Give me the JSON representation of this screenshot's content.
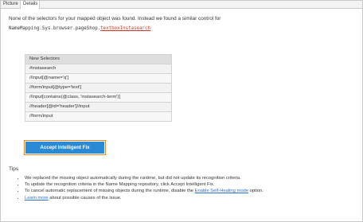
{
  "tabs": [
    {
      "label": "Picture",
      "active": false
    },
    {
      "label": "Details",
      "active": true
    }
  ],
  "message": "None of the selectors for your mapped object was found. Instead we found a similar control for",
  "path": {
    "prefix": "NameMapping.Sys.browser.pageShop.",
    "highlight": "textboxInstasearch"
  },
  "selectors": {
    "header": "New Selectors",
    "rows": [
      "#instasearch",
      "//input[@name='q']",
      "//form/input[@type='text']",
      "//input[contains(@class, 'instasearch-term')]",
      "//header[@id='header']//input",
      "//form/input"
    ]
  },
  "accept_button": "Accept Intelligent Fix",
  "tips": {
    "title": "Tips",
    "items": [
      {
        "text": "We replaced the missing object automatically during the runtime, but did not update its recognition criteria."
      },
      {
        "text": "To update the recognition criteria in the Name Mapping repository, click Accept Intelligent Fix."
      },
      {
        "pre": "To cancel automatic replacement of missing objects during the runtime, disable the ",
        "link": "Enable Self-Healing mode",
        "post": " option."
      },
      {
        "link": "Learn more",
        "post": " about possible causes of the issue."
      }
    ]
  },
  "colors": {
    "accent": "#2a8ad6",
    "focus_ring": "#e08a1e",
    "link": "#2a6fd0",
    "highlight": "#c0392b"
  }
}
